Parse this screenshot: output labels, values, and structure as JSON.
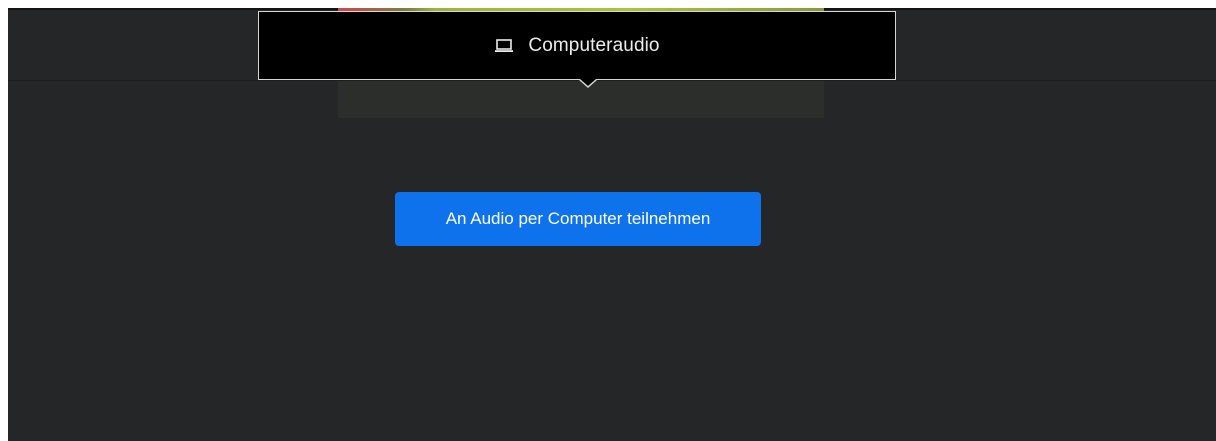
{
  "tooltip": {
    "icon": "laptop-icon",
    "label": "Computeraudio"
  },
  "join_button": {
    "label": "An Audio per Computer teilnehmen"
  },
  "colors": {
    "background": "#252628",
    "tooltip_background": "#000000",
    "tooltip_border": "#d6d6d6",
    "button_background": "#0e72ed",
    "button_text": "#ffffff"
  }
}
